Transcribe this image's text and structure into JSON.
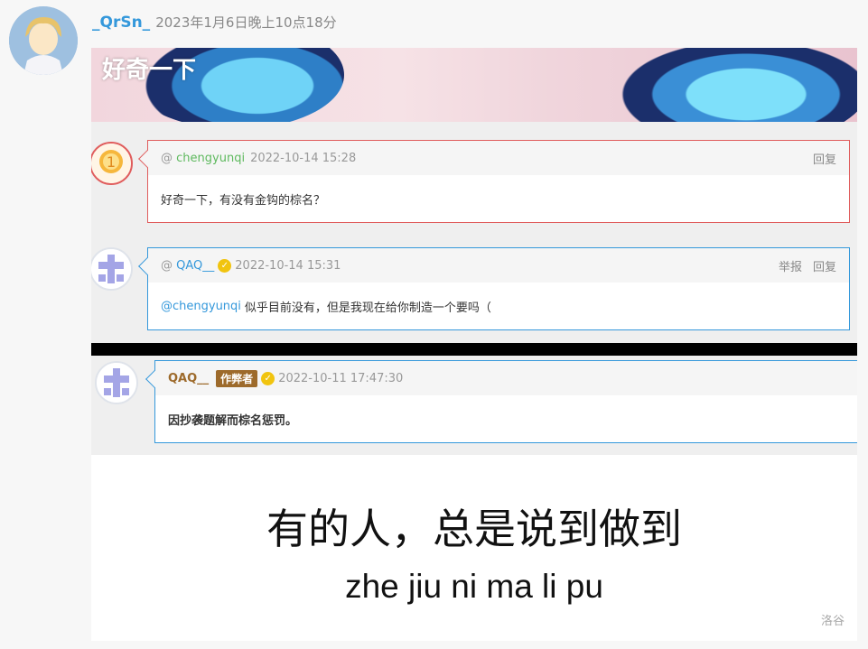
{
  "post": {
    "username": "_QrSn_",
    "time": "2023年1月6日晚上10点18分"
  },
  "banner": {
    "title": "好奇一下"
  },
  "comments": [
    {
      "author": "chengyunqi",
      "time": "2022-10-14 15:28",
      "text": "好奇一下，有没有金钩的棕名？",
      "actions": [
        "回复"
      ],
      "accent": "#e05d5d"
    },
    {
      "author": "QAQ__",
      "time": "2022-10-14 15:31",
      "mention": "@chengyunqi",
      "text": "似乎目前没有，但是我现在给你制造一个要吗（",
      "actions": [
        "举报",
        "回复"
      ],
      "accent": "#3498db"
    }
  ],
  "notice": {
    "author": "QAQ__",
    "tag": "作弊者",
    "time": "2022-10-11 17:47:30",
    "text": "因抄袭题解而棕名惩罚。",
    "accent": "#3498db"
  },
  "caption": {
    "main": "有的人，总是说到做到",
    "sub": "zhe jiu ni ma li pu"
  },
  "watermark": "洛谷",
  "colors": {
    "link_blue": "#3498db",
    "link_green": "#5eb95e",
    "cheater_brown": "#9d6a2b",
    "badge_gold": "#f1c40f"
  }
}
